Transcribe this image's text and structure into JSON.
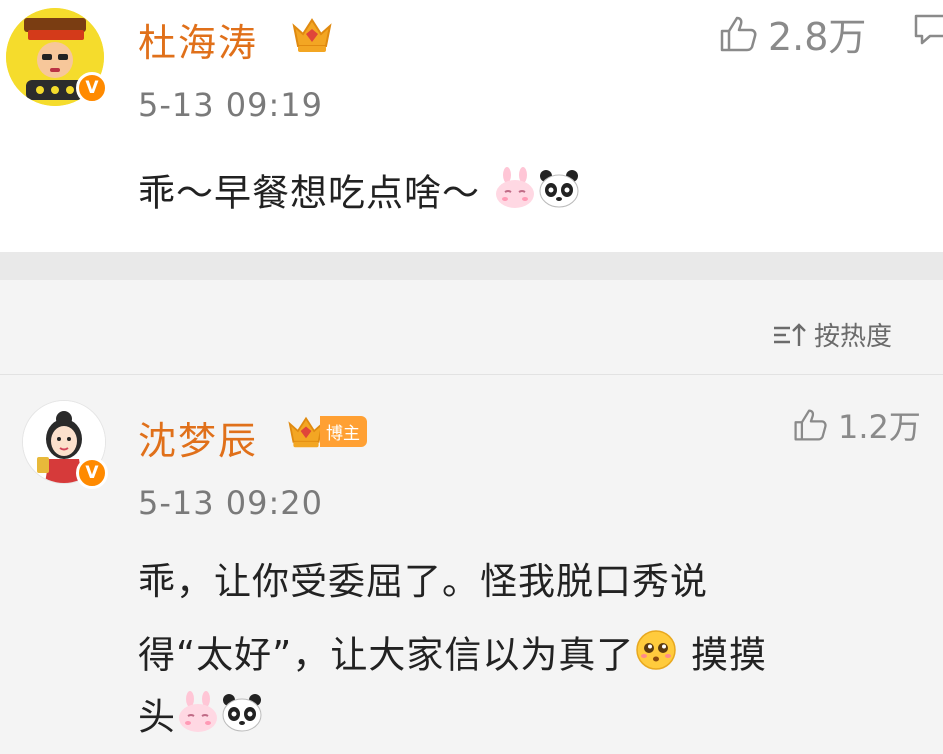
{
  "comments": [
    {
      "user": "杜海涛",
      "time": "5-13 09:19",
      "likes": "2.8万",
      "text": "乖～早餐想吃点啥～",
      "emoji": [
        "rabbit-emoji",
        "panda-emoji"
      ],
      "avatar_icon": "avatar-cartoon",
      "verified_badge": "V"
    },
    {
      "user": "沈梦辰",
      "tag": "博主",
      "time": "5-13 09:20",
      "likes": "1.2万",
      "text_lines": [
        "乖，让你受委屈了。怪我脱口秀说",
        "得“太好”，让大家信以为真了",
        "头"
      ],
      "inline_after_line2": "摸摸",
      "emoji": [
        "blushing-face-emoji",
        "rabbit-emoji",
        "panda-emoji"
      ],
      "avatar_icon": "avatar-cartoon-girl",
      "verified_badge": "V"
    }
  ],
  "sort": {
    "label": "按热度",
    "icon": "sort-icon"
  },
  "colors": {
    "username": "#e0701a",
    "badge": "#ff8a00",
    "tag_bg": "#ffa033",
    "meta": "#7a7a7a",
    "body_text": "#222222"
  }
}
